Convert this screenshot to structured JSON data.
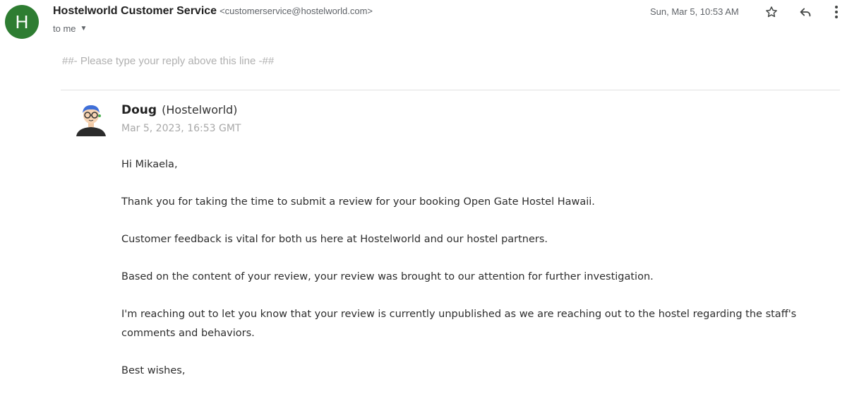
{
  "header": {
    "avatar_letter": "H",
    "sender_name": "Hostelworld Customer Service",
    "sender_email": "<customerservice@hostelworld.com>",
    "recipient": "to me",
    "date": "Sun, Mar 5, 10:53 AM",
    "icons": [
      "star-icon",
      "reply-icon",
      "more-vert-icon",
      "chevron-down-icon"
    ],
    "avatar_color": "#2e7d32"
  },
  "message": {
    "reply_marker": "##- Please type your reply above this line -##",
    "agent_name": "Doug",
    "agent_org": "(Hostelworld)",
    "agent_date": "Mar 5, 2023, 16:53 GMT",
    "paragraphs": [
      "Hi Mikaela,",
      "Thank you for taking the time to submit a review for your booking Open Gate Hostel Hawaii.",
      "Customer feedback is vital for both us here at Hostelworld and our hostel partners.",
      "Based on the content of your review, your review was brought to our attention for further investigation.",
      "I'm reaching out to let you know that your review is currently unpublished as we are reaching out to the hostel regarding the staff's comments and behaviors.",
      "Best wishes,"
    ]
  }
}
